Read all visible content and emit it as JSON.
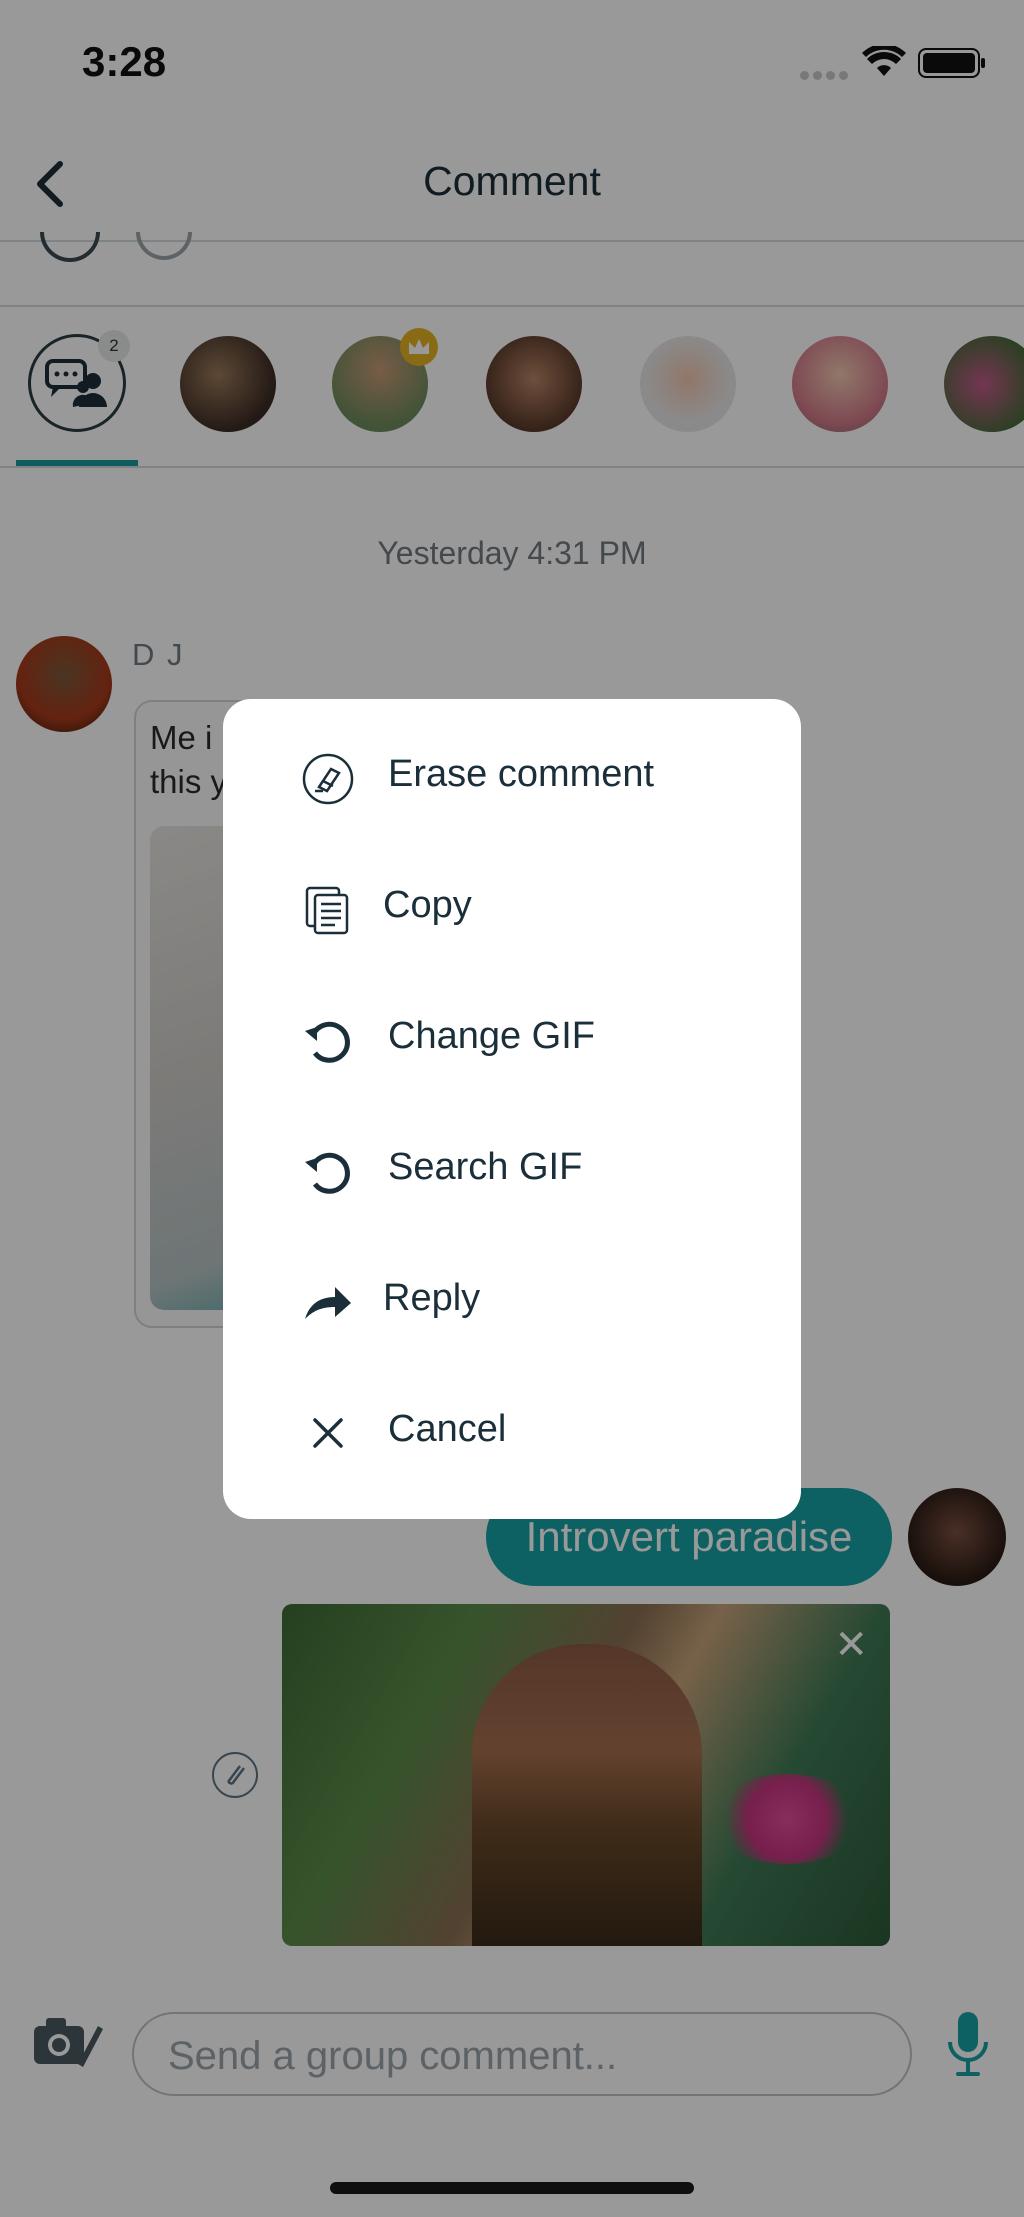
{
  "status": {
    "time": "3:28"
  },
  "nav": {
    "title": "Comment",
    "back_label": ""
  },
  "participants": {
    "group_count_badge": "2"
  },
  "chat": {
    "timestamp": "Yesterday 4:31 PM",
    "sender_name": "D J",
    "incoming_text_line1": "Me i",
    "incoming_text_line2": "this y",
    "my_message": "Introvert paradise"
  },
  "composer": {
    "placeholder": "Send a group comment..."
  },
  "context_menu": {
    "items": [
      {
        "label": "Erase comment",
        "icon": "erase-icon"
      },
      {
        "label": "Copy",
        "icon": "copy-icon"
      },
      {
        "label": "Change GIF",
        "icon": "refresh-icon"
      },
      {
        "label": "Search GIF",
        "icon": "refresh-icon"
      },
      {
        "label": "Reply",
        "icon": "reply-arrow-icon"
      },
      {
        "label": "Cancel",
        "icon": "close-icon"
      }
    ]
  },
  "colors": {
    "accent": "#16a2a6",
    "text": "#1b2f3a",
    "overlay": "rgba(0,0,0,0.40)"
  }
}
